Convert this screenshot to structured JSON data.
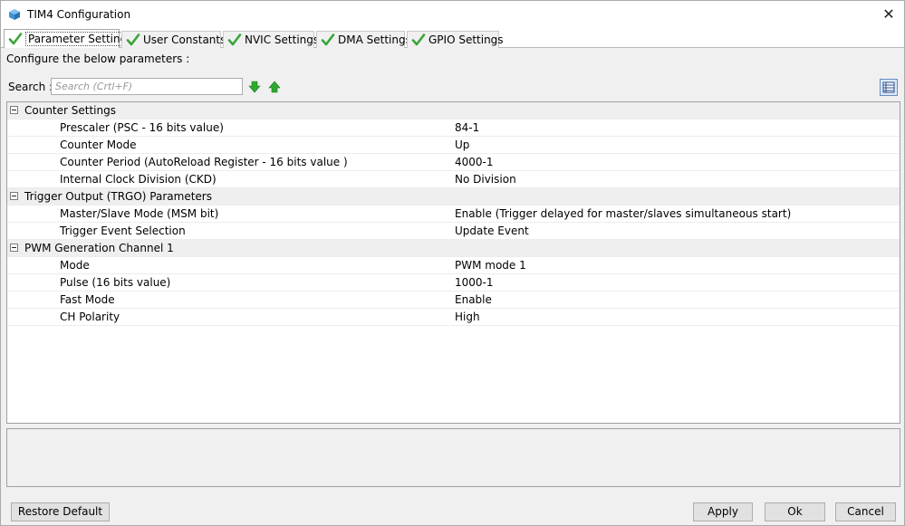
{
  "window": {
    "title": "TIM4 Configuration",
    "close_glyph": "✕"
  },
  "tabs": [
    {
      "label": "Parameter Settings",
      "active": true
    },
    {
      "label": "User Constants"
    },
    {
      "label": "NVIC Settings"
    },
    {
      "label": "DMA Settings"
    },
    {
      "label": "GPIO Settings"
    }
  ],
  "description": "Configure the below parameters :",
  "search": {
    "label": "Search :",
    "placeholder": "Search (Crtl+F)"
  },
  "groups": [
    {
      "title": "Counter Settings",
      "params": [
        {
          "name": "Prescaler (PSC - 16 bits value)",
          "value": "84-1"
        },
        {
          "name": "Counter Mode",
          "value": "Up"
        },
        {
          "name": "Counter Period (AutoReload Register - 16 bits value )",
          "value": "4000-1"
        },
        {
          "name": "Internal Clock Division (CKD)",
          "value": "No Division"
        }
      ]
    },
    {
      "title": "Trigger Output (TRGO) Parameters",
      "params": [
        {
          "name": "Master/Slave Mode (MSM bit)",
          "value": "Enable (Trigger delayed for master/slaves simultaneous start)"
        },
        {
          "name": "Trigger Event Selection",
          "value": "Update Event"
        }
      ]
    },
    {
      "title": "PWM Generation Channel 1",
      "params": [
        {
          "name": "Mode",
          "value": "PWM mode 1"
        },
        {
          "name": "Pulse (16 bits value)",
          "value": "1000-1"
        },
        {
          "name": "Fast Mode",
          "value": "Enable"
        },
        {
          "name": "CH Polarity",
          "value": "High"
        }
      ]
    }
  ],
  "buttons": {
    "restore_default": "Restore Default",
    "apply": "Apply",
    "ok": "Ok",
    "cancel": "Cancel"
  },
  "icons": {
    "app": "cube-icon",
    "tab_status": "green-check-icon",
    "search_next": "arrow-down-icon",
    "search_prev": "arrow-up-icon",
    "view_toggle": "list-view-icon"
  },
  "colors": {
    "check_green": "#3aa53a",
    "arrow_green": "#2fa82f",
    "group_row_bg": "#efefef"
  }
}
